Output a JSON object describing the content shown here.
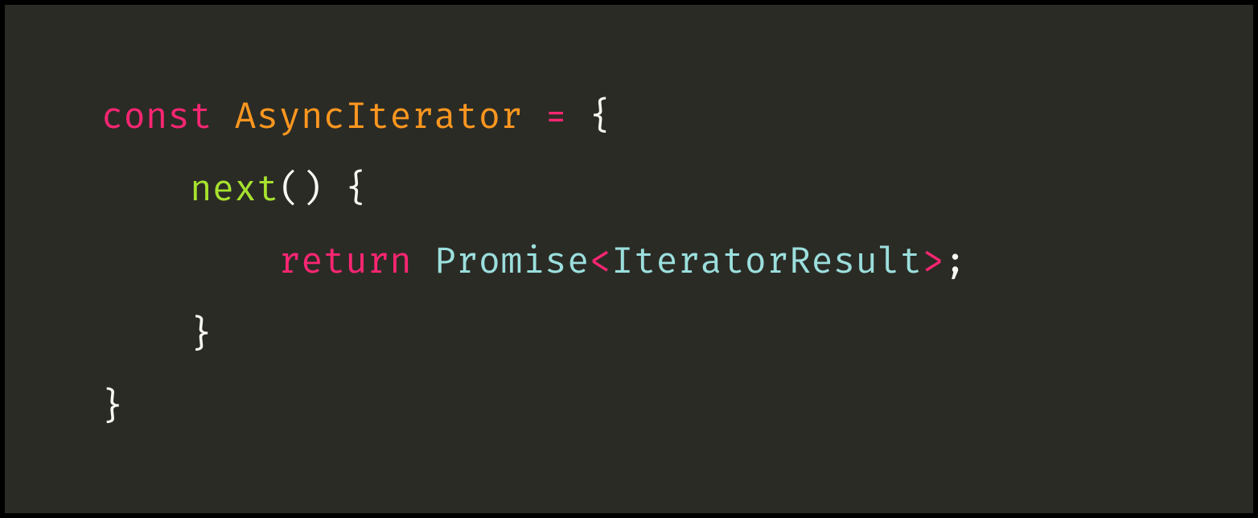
{
  "code": {
    "line1": {
      "const": "const",
      "sp1": " ",
      "className": "AsyncIterator",
      "sp2": " ",
      "eq": "=",
      "sp3": " ",
      "brace": "{"
    },
    "line2": {
      "indent": "    ",
      "method": "next",
      "parens": "()",
      "sp": " ",
      "brace": "{"
    },
    "line3": {
      "indent": "        ",
      "ret": "return",
      "sp": " ",
      "type1": "Promise",
      "lt": "<",
      "type2": "IteratorResult",
      "gt": ">",
      "semi": ";"
    },
    "line4": {
      "indent": "    ",
      "brace": "}"
    },
    "line5": {
      "brace": "}"
    }
  }
}
